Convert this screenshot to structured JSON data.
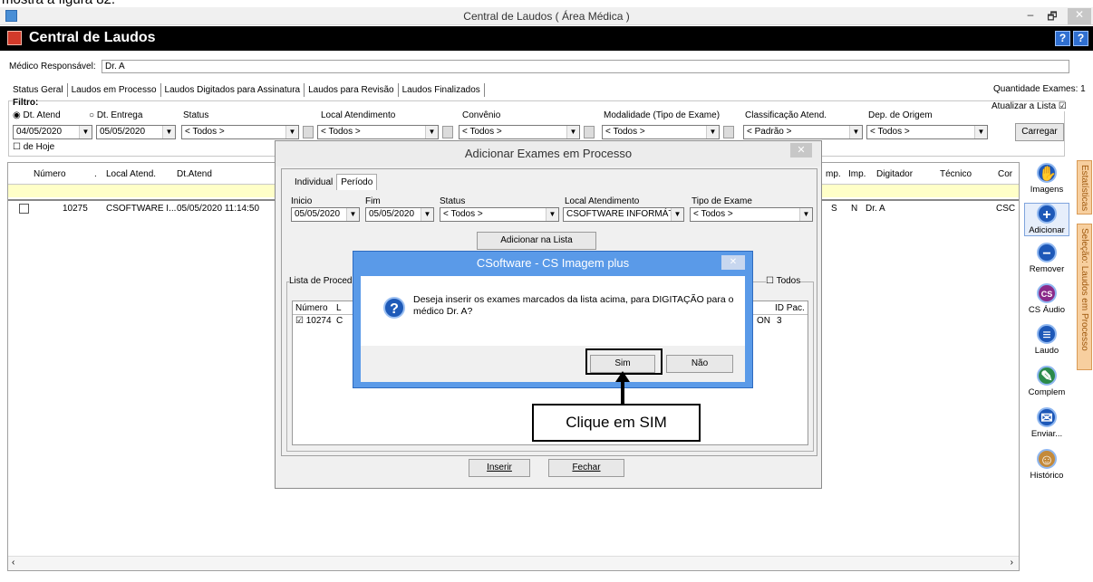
{
  "caption": "mostra a figura 82.",
  "window": {
    "title": "Central de Laudos ( Área Médica )",
    "min": "–",
    "max": "🗗",
    "close": "✕"
  },
  "app": {
    "name": "Central de Laudos",
    "btn_help1": "?",
    "btn_help2": "?"
  },
  "header": {
    "medico_label": "Médico Responsável:",
    "medico_value": "Dr. A",
    "quantidade": "Quantidade Exames: 1"
  },
  "tabs": [
    "Status Geral",
    "Laudos em Processo",
    "Laudos Digitados para Assinatura",
    "Laudos para Revisão",
    "Laudos Finalizados"
  ],
  "filter": {
    "title": "Filtro:",
    "dt_atend": "Dt. Atend",
    "dt_entrega": "Dt. Entrega",
    "date1": "04/05/2020",
    "date2": "05/05/2020",
    "de_hoje": "de Hoje",
    "status_label": "Status",
    "status_value": "< Todos >",
    "local_label": "Local Atendimento",
    "local_value": "< Todos >",
    "convenio_label": "Convênio",
    "convenio_value": "< Todos >",
    "modalidade_label": "Modalidade (Tipo de Exame)",
    "modalidade_value": "< Todos >",
    "classificacao_label": "Classificação Atend.",
    "classificacao_value": "< Padrão >",
    "dep_label": "Dep. de Origem",
    "dep_value": "< Todos >",
    "atualizar": "Atualizar a Lista",
    "carregar": "Carregar"
  },
  "grid": {
    "headers": {
      "numero": "Número",
      "dot": ".",
      "local": "Local Atend.",
      "dtatend": "Dt.Atend",
      "imp1": "mp.",
      "imp2": "Imp.",
      "digitador": "Digitador",
      "tecnico": "Técnico",
      "cor": "Cor"
    },
    "row": {
      "numero": "10275",
      "local": "CSOFTWARE I...",
      "dtatend": "05/05/2020 11:14:50",
      "s": "S",
      "n": "N",
      "digitador": "Dr. A",
      "cor": "CSC"
    }
  },
  "sidebar": {
    "imagens": "Imagens",
    "adicionar": "Adicionar",
    "remover": "Remover",
    "csaudio": "CS Áudio",
    "laudo": "Laudo",
    "complem": "Complem",
    "enviar": "Enviar...",
    "historico": "Histórico",
    "cs_ic": "CS"
  },
  "vtabs": {
    "estatisticas": "Estatísticas",
    "selecao": "Seleção: Laudos em Processo"
  },
  "dialog": {
    "title": "Adicionar Exames em Processo",
    "close": "✕",
    "tabs": [
      "Individual",
      "Período"
    ],
    "inicio_label": "Inicio",
    "inicio_value": "05/05/2020",
    "fim_label": "Fim",
    "fim_value": "05/05/2020",
    "status_label": "Status",
    "status_value": "< Todos >",
    "local_label": "Local Atendimento",
    "local_value": "CSOFTWARE INFORMÁTI",
    "tipo_label": "Tipo de Exame",
    "tipo_value": "< Todos >",
    "adicionar_lista": "Adicionar na Lista",
    "lista_label": "Lista de Procedir",
    "todos": "Todos",
    "col_numero": "Número",
    "col_l": "L",
    "col_idpac": "ID Pac.",
    "row_numero": "10274",
    "row_c": "C",
    "row_on": "ON",
    "row_idpac": "3",
    "inserir": "Inserir",
    "fechar": "Fechar"
  },
  "msgbox": {
    "title": "CSoftware - CS Imagem plus",
    "close": "✕",
    "text": "Deseja inserir os exames marcados da lista acima, para DIGITAÇÃO para o médico Dr. A?",
    "sim": "Sim",
    "nao": "Não"
  },
  "callout": "Clique em SIM"
}
